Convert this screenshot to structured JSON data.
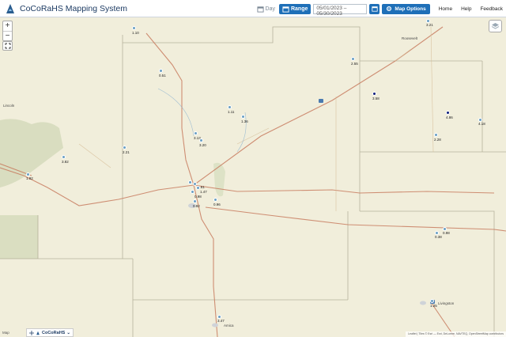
{
  "header": {
    "title": "CoCoRaHS Mapping System",
    "day_label": "Day",
    "range_label": "Range",
    "start_date": "05/01/2023",
    "end_date": "05/30/2023",
    "map_options_label": "Map Options",
    "nav": [
      "Home",
      "Help",
      "Feedback"
    ]
  },
  "map": {
    "brand_label": "CoCoRaHS",
    "layer_label": "Map",
    "attribution": "Leaflet | Tiles © Esri — Esri, DeLorme, NAVTEQ, OpenStreetMap contributors",
    "places": [
      "Roosevelt",
      "Lincoln",
      "Amica",
      "Livingston"
    ],
    "stations": [
      {
        "label": "1.10",
        "dark": false
      },
      {
        "label": "3.21",
        "dark": false
      },
      {
        "label": "0.51",
        "dark": false
      },
      {
        "label": "2.55",
        "dark": false
      },
      {
        "label": "3.58",
        "dark": true
      },
      {
        "label": "1.11",
        "dark": false
      },
      {
        "label": "1.36",
        "dark": false
      },
      {
        "label": "4.86",
        "dark": true
      },
      {
        "label": "4.18",
        "dark": false
      },
      {
        "label": "3.13",
        "dark": false
      },
      {
        "label": "3.20",
        "dark": false
      },
      {
        "label": "2.28",
        "dark": false
      },
      {
        "label": "2.21",
        "dark": false
      },
      {
        "label": "3.82",
        "dark": false
      },
      {
        "label": "1.92",
        "dark": false
      },
      {
        "label": "1.61",
        "dark": false
      },
      {
        "label": "1.47",
        "dark": false
      },
      {
        "label": "0.98",
        "dark": false
      },
      {
        "label": "0.96",
        "dark": false
      },
      {
        "label": "0.92",
        "dark": false
      },
      {
        "label": "0.98",
        "dark": false
      },
      {
        "label": "0.38",
        "dark": false
      },
      {
        "label": "1.25",
        "dark": false
      },
      {
        "label": "3.47",
        "dark": false
      }
    ]
  }
}
